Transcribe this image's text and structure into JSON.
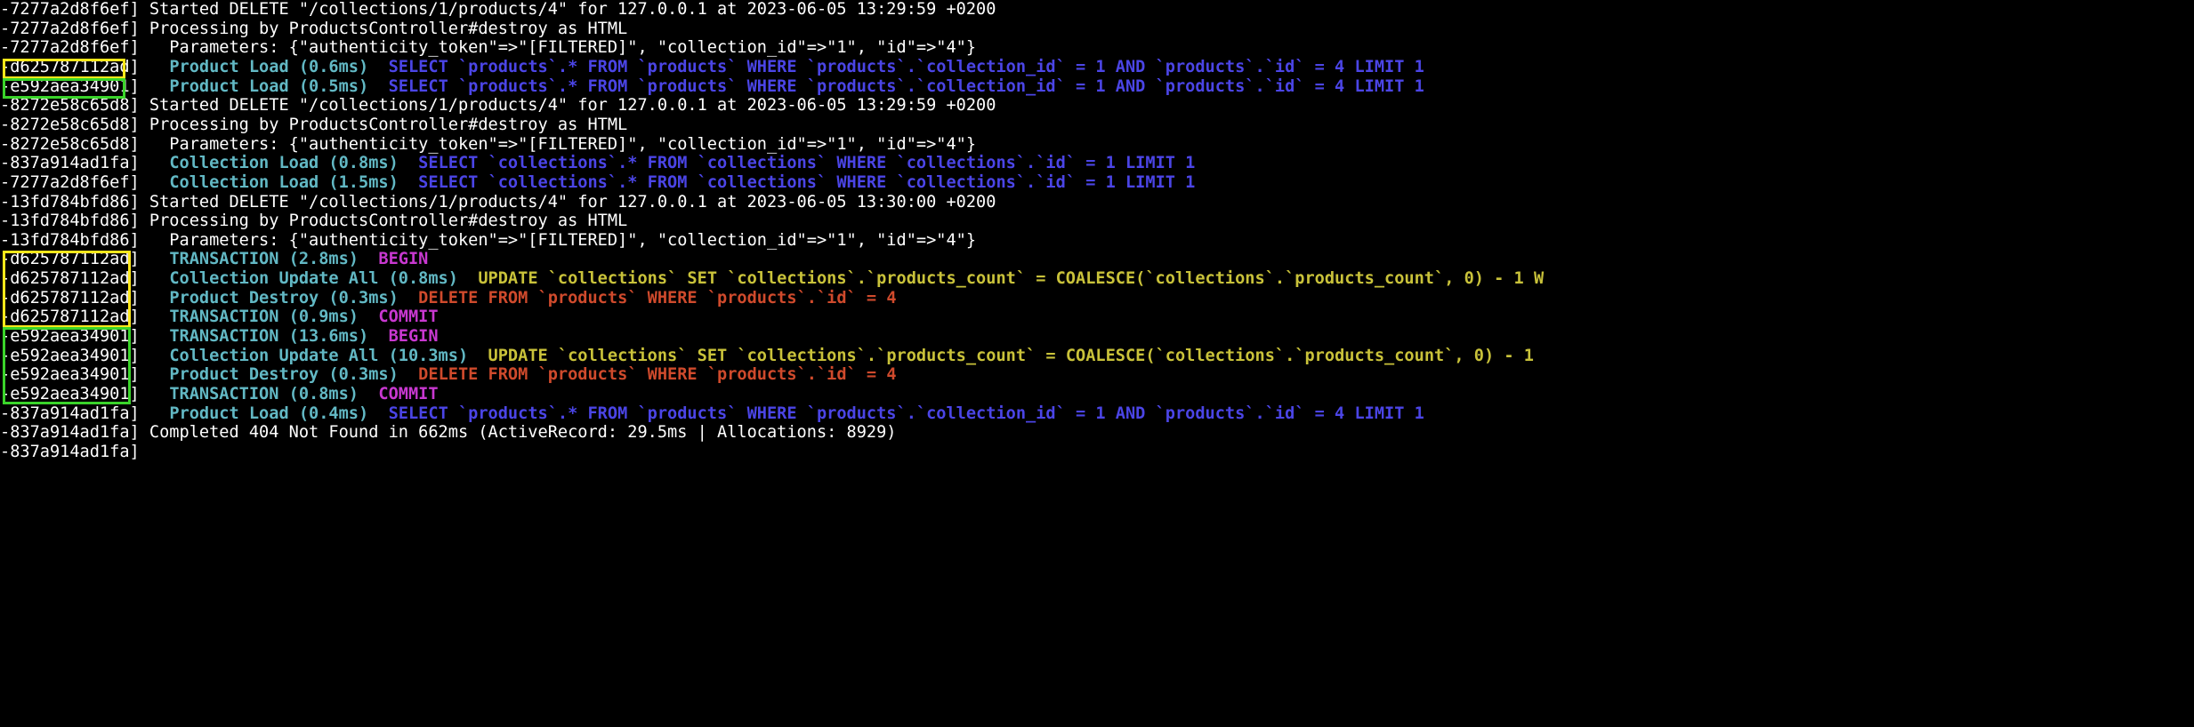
{
  "colors": {
    "background": "#000000",
    "default_text": "#ffffff",
    "model_name": "#62b8c4",
    "select_sql": "#4b45e6",
    "update_sql": "#c9c23a",
    "delete_sql": "#cf4a2c",
    "transaction_sql": "#c838d0",
    "highlight_yellow": "#ffe81a",
    "highlight_green": "#3ad42a"
  },
  "lines": [
    [
      {
        "t": "-7277a2d8f6ef] Started DELETE \"/collections/1/products/4\" for 127.0.0.1 at 2023-06-05 13:29:59 +0200",
        "c": "white"
      }
    ],
    [
      {
        "t": "-7277a2d8f6ef] Processing by ProductsController#destroy as HTML",
        "c": "white"
      }
    ],
    [
      {
        "t": "-7277a2d8f6ef]   Parameters: {\"authenticity_token\"=>\"[FILTERED]\", \"collection_id\"=>\"1\", \"id\"=>\"4\"}",
        "c": "white"
      }
    ],
    [
      {
        "t": "-d625787112ad]   ",
        "c": "white"
      },
      {
        "t": "Product Load (0.6ms)",
        "c": "cyan"
      },
      {
        "t": "  SELECT `products`.* FROM `products` WHERE `products`.`collection_id` = 1 AND `products`.`id` = 4 LIMIT 1",
        "c": "blue"
      }
    ],
    [
      {
        "t": "-e592aea34901]   ",
        "c": "white"
      },
      {
        "t": "Product Load (0.5ms)",
        "c": "cyan"
      },
      {
        "t": "  SELECT `products`.* FROM `products` WHERE `products`.`collection_id` = 1 AND `products`.`id` = 4 LIMIT 1",
        "c": "blue"
      }
    ],
    [
      {
        "t": "-8272e58c65d8] Started DELETE \"/collections/1/products/4\" for 127.0.0.1 at 2023-06-05 13:29:59 +0200",
        "c": "white"
      }
    ],
    [
      {
        "t": "-8272e58c65d8] Processing by ProductsController#destroy as HTML",
        "c": "white"
      }
    ],
    [
      {
        "t": "-8272e58c65d8]   Parameters: {\"authenticity_token\"=>\"[FILTERED]\", \"collection_id\"=>\"1\", \"id\"=>\"4\"}",
        "c": "white"
      }
    ],
    [
      {
        "t": "-837a914ad1fa]   ",
        "c": "white"
      },
      {
        "t": "Collection Load (0.8ms)",
        "c": "cyan"
      },
      {
        "t": "  SELECT `collections`.* FROM `collections` WHERE `collections`.`id` = 1 LIMIT 1",
        "c": "blue"
      }
    ],
    [
      {
        "t": "-7277a2d8f6ef]   ",
        "c": "white"
      },
      {
        "t": "Collection Load (1.5ms)",
        "c": "cyan"
      },
      {
        "t": "  SELECT `collections`.* FROM `collections` WHERE `collections`.`id` = 1 LIMIT 1",
        "c": "blue"
      }
    ],
    [
      {
        "t": "-13fd784bfd86] Started DELETE \"/collections/1/products/4\" for 127.0.0.1 at 2023-06-05 13:30:00 +0200",
        "c": "white"
      }
    ],
    [
      {
        "t": "-13fd784bfd86] Processing by ProductsController#destroy as HTML",
        "c": "white"
      }
    ],
    [
      {
        "t": "-13fd784bfd86]   Parameters: {\"authenticity_token\"=>\"[FILTERED]\", \"collection_id\"=>\"1\", \"id\"=>\"4\"}",
        "c": "white"
      }
    ],
    [
      {
        "t": "-d625787112ad]   ",
        "c": "white"
      },
      {
        "t": "TRANSACTION (2.8ms)",
        "c": "cyan"
      },
      {
        "t": "  BEGIN",
        "c": "magenta"
      }
    ],
    [
      {
        "t": "-d625787112ad]   ",
        "c": "white"
      },
      {
        "t": "Collection Update All (0.8ms)",
        "c": "cyan"
      },
      {
        "t": "  UPDATE `collections` SET `collections`.`products_count` = COALESCE(`collections`.`products_count`, 0) - 1 W",
        "c": "yellow"
      }
    ],
    [
      {
        "t": "-d625787112ad]   ",
        "c": "white"
      },
      {
        "t": "Product Destroy (0.3ms)",
        "c": "cyan"
      },
      {
        "t": "  DELETE FROM `products` WHERE `products`.`id` = 4",
        "c": "red"
      }
    ],
    [
      {
        "t": "-d625787112ad]   ",
        "c": "white"
      },
      {
        "t": "TRANSACTION (0.9ms)",
        "c": "cyan"
      },
      {
        "t": "  COMMIT",
        "c": "magenta"
      }
    ],
    [
      {
        "t": "-e592aea34901]   ",
        "c": "white"
      },
      {
        "t": "TRANSACTION (13.6ms)",
        "c": "cyan"
      },
      {
        "t": "  BEGIN",
        "c": "magenta"
      }
    ],
    [
      {
        "t": "-e592aea34901]   ",
        "c": "white"
      },
      {
        "t": "Collection Update All (10.3ms)",
        "c": "cyan"
      },
      {
        "t": "  UPDATE `collections` SET `collections`.`products_count` = COALESCE(`collections`.`products_count`, 0) - 1",
        "c": "yellow"
      }
    ],
    [
      {
        "t": "-e592aea34901]   ",
        "c": "white"
      },
      {
        "t": "Product Destroy (0.3ms)",
        "c": "cyan"
      },
      {
        "t": "  DELETE FROM `products` WHERE `products`.`id` = 4",
        "c": "red"
      }
    ],
    [
      {
        "t": "-e592aea34901]   ",
        "c": "white"
      },
      {
        "t": "TRANSACTION (0.8ms)",
        "c": "cyan"
      },
      {
        "t": "  COMMIT",
        "c": "magenta"
      }
    ],
    [
      {
        "t": "-837a914ad1fa]   ",
        "c": "white"
      },
      {
        "t": "Product Load (0.4ms)",
        "c": "cyan"
      },
      {
        "t": "  SELECT `products`.* FROM `products` WHERE `products`.`collection_id` = 1 AND `products`.`id` = 4 LIMIT 1",
        "c": "blue"
      }
    ],
    [
      {
        "t": "-837a914ad1fa] Completed 404 Not Found in 662ms (ActiveRecord: 29.5ms | Allocations: 8929)",
        "c": "white"
      }
    ],
    [
      {
        "t": "-837a914ad1fa]",
        "c": "white"
      }
    ]
  ]
}
